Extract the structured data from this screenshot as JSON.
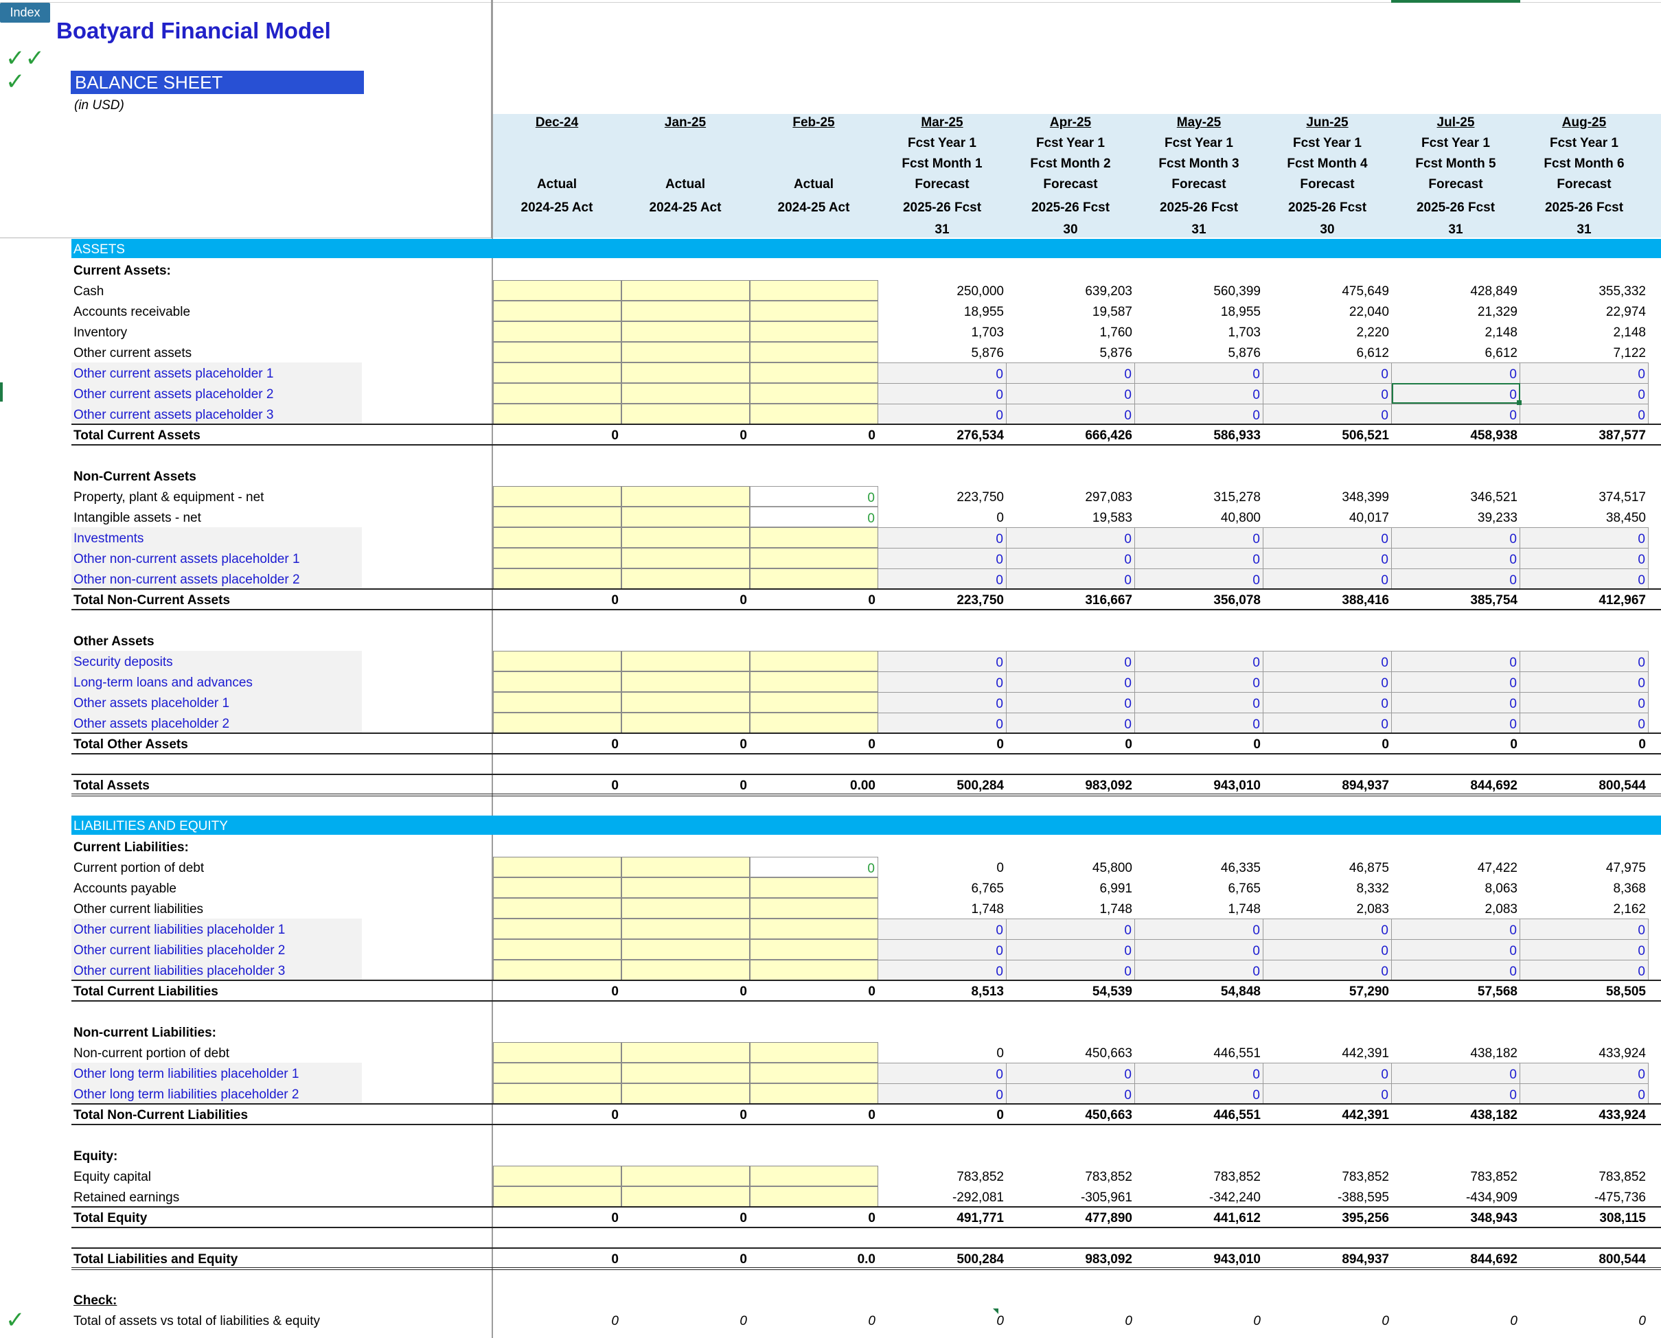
{
  "app": {
    "index_label": "Index",
    "title": "Boatyard Financial Model",
    "sheet_title": "BALANCE SHEET",
    "unit_note": "(in USD)",
    "check_marks": [
      "✓✓",
      "✓",
      "✓"
    ]
  },
  "columns": [
    {
      "date": "Dec-24",
      "l1": "",
      "l2": "",
      "l3": "Actual",
      "l4": "2024-25 Act",
      "l5": ""
    },
    {
      "date": "Jan-25",
      "l1": "",
      "l2": "",
      "l3": "Actual",
      "l4": "2024-25 Act",
      "l5": ""
    },
    {
      "date": "Feb-25",
      "l1": "",
      "l2": "",
      "l3": "Actual",
      "l4": "2024-25 Act",
      "l5": ""
    },
    {
      "date": "Mar-25",
      "l1": "Fcst Year 1",
      "l2": "Fcst Month 1",
      "l3": "Forecast",
      "l4": "2025-26 Fcst",
      "l5": "31"
    },
    {
      "date": "Apr-25",
      "l1": "Fcst Year 1",
      "l2": "Fcst Month 2",
      "l3": "Forecast",
      "l4": "2025-26 Fcst",
      "l5": "30"
    },
    {
      "date": "May-25",
      "l1": "Fcst Year 1",
      "l2": "Fcst Month 3",
      "l3": "Forecast",
      "l4": "2025-26 Fcst",
      "l5": "31"
    },
    {
      "date": "Jun-25",
      "l1": "Fcst Year 1",
      "l2": "Fcst Month 4",
      "l3": "Forecast",
      "l4": "2025-26 Fcst",
      "l5": "30"
    },
    {
      "date": "Jul-25",
      "l1": "Fcst Year 1",
      "l2": "Fcst Month 5",
      "l3": "Forecast",
      "l4": "2025-26 Fcst",
      "l5": "31"
    },
    {
      "date": "Aug-25",
      "l1": "Fcst Year 1",
      "l2": "Fcst Month 6",
      "l3": "Forecast",
      "l4": "2025-26 Fcst",
      "l5": "31"
    }
  ],
  "rows": [
    {
      "kind": "band",
      "label": "ASSETS"
    },
    {
      "kind": "heading",
      "label": "Current Assets:"
    },
    {
      "kind": "data",
      "label": "Cash",
      "values": [
        "",
        "",
        "",
        "250,000",
        "639,203",
        "560,399",
        "475,649",
        "428,849",
        "355,332"
      ]
    },
    {
      "kind": "data",
      "label": "Accounts receivable",
      "values": [
        "",
        "",
        "",
        "18,955",
        "19,587",
        "18,955",
        "22,040",
        "21,329",
        "22,974"
      ]
    },
    {
      "kind": "data",
      "label": "Inventory",
      "values": [
        "",
        "",
        "",
        "1,703",
        "1,760",
        "1,703",
        "2,220",
        "2,148",
        "2,148"
      ]
    },
    {
      "kind": "data",
      "label": "Other current assets",
      "values": [
        "",
        "",
        "",
        "5,876",
        "5,876",
        "5,876",
        "6,612",
        "6,612",
        "7,122"
      ]
    },
    {
      "kind": "ph",
      "label": "Other current assets placeholder 1",
      "values": [
        "",
        "",
        "",
        "0",
        "0",
        "0",
        "0",
        "0",
        "0"
      ]
    },
    {
      "kind": "ph",
      "label": "Other current assets placeholder 2",
      "values": [
        "",
        "",
        "",
        "0",
        "0",
        "0",
        "0",
        "0",
        "0"
      ]
    },
    {
      "kind": "ph",
      "label": "Other current assets placeholder 3",
      "values": [
        "",
        "",
        "",
        "0",
        "0",
        "0",
        "0",
        "0",
        "0"
      ]
    },
    {
      "kind": "total",
      "label": "Total Current Assets",
      "values": [
        "0",
        "0",
        "0",
        "276,534",
        "666,426",
        "586,933",
        "506,521",
        "458,938",
        "387,577"
      ]
    },
    {
      "kind": "blank"
    },
    {
      "kind": "heading",
      "label": "Non-Current Assets"
    },
    {
      "kind": "data3w",
      "label": "Property, plant & equipment - net",
      "values": [
        "",
        "",
        "0",
        "223,750",
        "297,083",
        "315,278",
        "348,399",
        "346,521",
        "374,517"
      ]
    },
    {
      "kind": "data3w",
      "label": "Intangible assets - net",
      "values": [
        "",
        "",
        "0",
        "0",
        "19,583",
        "40,800",
        "40,017",
        "39,233",
        "38,450"
      ]
    },
    {
      "kind": "ph",
      "label": "Investments",
      "values": [
        "",
        "",
        "",
        "0",
        "0",
        "0",
        "0",
        "0",
        "0"
      ]
    },
    {
      "kind": "ph",
      "label": "Other non-current assets placeholder 1",
      "values": [
        "",
        "",
        "",
        "0",
        "0",
        "0",
        "0",
        "0",
        "0"
      ]
    },
    {
      "kind": "ph",
      "label": "Other non-current assets placeholder 2",
      "values": [
        "",
        "",
        "",
        "0",
        "0",
        "0",
        "0",
        "0",
        "0"
      ]
    },
    {
      "kind": "total",
      "label": "Total Non-Current Assets",
      "values": [
        "0",
        "0",
        "0",
        "223,750",
        "316,667",
        "356,078",
        "388,416",
        "385,754",
        "412,967"
      ]
    },
    {
      "kind": "blank"
    },
    {
      "kind": "heading",
      "label": "Other Assets"
    },
    {
      "kind": "ph",
      "label": "Security deposits",
      "values": [
        "",
        "",
        "",
        "0",
        "0",
        "0",
        "0",
        "0",
        "0"
      ]
    },
    {
      "kind": "ph",
      "label": "Long-term loans and advances",
      "values": [
        "",
        "",
        "",
        "0",
        "0",
        "0",
        "0",
        "0",
        "0"
      ]
    },
    {
      "kind": "ph",
      "label": "Other  assets placeholder 1",
      "values": [
        "",
        "",
        "",
        "0",
        "0",
        "0",
        "0",
        "0",
        "0"
      ]
    },
    {
      "kind": "ph",
      "label": "Other  assets placeholder 2",
      "values": [
        "",
        "",
        "",
        "0",
        "0",
        "0",
        "0",
        "0",
        "0"
      ]
    },
    {
      "kind": "total",
      "label": "Total Other  Assets",
      "values": [
        "0",
        "0",
        "0",
        "0",
        "0",
        "0",
        "0",
        "0",
        "0"
      ]
    },
    {
      "kind": "blank"
    },
    {
      "kind": "grand",
      "label": "Total Assets",
      "values": [
        "0",
        "0",
        "0.00",
        "500,284",
        "983,092",
        "943,010",
        "894,937",
        "844,692",
        "800,544"
      ]
    },
    {
      "kind": "blank"
    },
    {
      "kind": "band",
      "label": "LIABILITIES AND EQUITY"
    },
    {
      "kind": "heading",
      "label": "Current Liabilities:"
    },
    {
      "kind": "data3w",
      "label": "Current portion of debt",
      "values": [
        "",
        "",
        "0",
        "0",
        "45,800",
        "46,335",
        "46,875",
        "47,422",
        "47,975"
      ]
    },
    {
      "kind": "data",
      "label": "Accounts payable",
      "values": [
        "",
        "",
        "",
        "6,765",
        "6,991",
        "6,765",
        "8,332",
        "8,063",
        "8,368"
      ]
    },
    {
      "kind": "data",
      "label": "Other current liabilities",
      "values": [
        "",
        "",
        "",
        "1,748",
        "1,748",
        "1,748",
        "2,083",
        "2,083",
        "2,162"
      ]
    },
    {
      "kind": "ph",
      "label": "Other current liabilities placeholder 1",
      "values": [
        "",
        "",
        "",
        "0",
        "0",
        "0",
        "0",
        "0",
        "0"
      ]
    },
    {
      "kind": "ph",
      "label": "Other current liabilities placeholder 2",
      "values": [
        "",
        "",
        "",
        "0",
        "0",
        "0",
        "0",
        "0",
        "0"
      ]
    },
    {
      "kind": "ph",
      "label": "Other current liabilities placeholder 3",
      "values": [
        "",
        "",
        "",
        "0",
        "0",
        "0",
        "0",
        "0",
        "0"
      ]
    },
    {
      "kind": "total",
      "label": "Total Current Liabilities",
      "values": [
        "0",
        "0",
        "0",
        "8,513",
        "54,539",
        "54,848",
        "57,290",
        "57,568",
        "58,505"
      ]
    },
    {
      "kind": "blank"
    },
    {
      "kind": "heading",
      "label": "Non-current Liabilities:"
    },
    {
      "kind": "data",
      "label": "Non-current portion of debt",
      "values": [
        "",
        "",
        "",
        "0",
        "450,663",
        "446,551",
        "442,391",
        "438,182",
        "433,924"
      ]
    },
    {
      "kind": "ph",
      "label": "Other long term liabilities placeholder 1",
      "values": [
        "",
        "",
        "",
        "0",
        "0",
        "0",
        "0",
        "0",
        "0"
      ]
    },
    {
      "kind": "ph",
      "label": "Other long term liabilities placeholder 2",
      "values": [
        "",
        "",
        "",
        "0",
        "0",
        "0",
        "0",
        "0",
        "0"
      ]
    },
    {
      "kind": "total",
      "label": "Total Non-Current Liabilities",
      "values": [
        "0",
        "0",
        "0",
        "0",
        "450,663",
        "446,551",
        "442,391",
        "438,182",
        "433,924"
      ]
    },
    {
      "kind": "blank"
    },
    {
      "kind": "heading",
      "label": "Equity:"
    },
    {
      "kind": "data",
      "label": "Equity capital",
      "values": [
        "",
        "",
        "",
        "783,852",
        "783,852",
        "783,852",
        "783,852",
        "783,852",
        "783,852"
      ]
    },
    {
      "kind": "data",
      "label": "Retained earnings",
      "values": [
        "",
        "",
        "",
        "-292,081",
        "-305,961",
        "-342,240",
        "-388,595",
        "-434,909",
        "-475,736"
      ]
    },
    {
      "kind": "total",
      "label": "Total Equity",
      "values": [
        "0",
        "0",
        "0",
        "491,771",
        "477,890",
        "441,612",
        "395,256",
        "348,943",
        "308,115"
      ]
    },
    {
      "kind": "blank"
    },
    {
      "kind": "grand",
      "label": "Total Liabilities and Equity",
      "values": [
        "0",
        "0",
        "0.0",
        "500,284",
        "983,092",
        "943,010",
        "894,937",
        "844,692",
        "800,544"
      ]
    },
    {
      "kind": "blank"
    },
    {
      "kind": "checkhead",
      "label": "Check:"
    },
    {
      "kind": "check",
      "label": "Total of assets vs total of  liabilities & equity",
      "values": [
        "0",
        "0",
        "0",
        "0",
        "0",
        "0",
        "0",
        "0",
        "0"
      ]
    }
  ]
}
